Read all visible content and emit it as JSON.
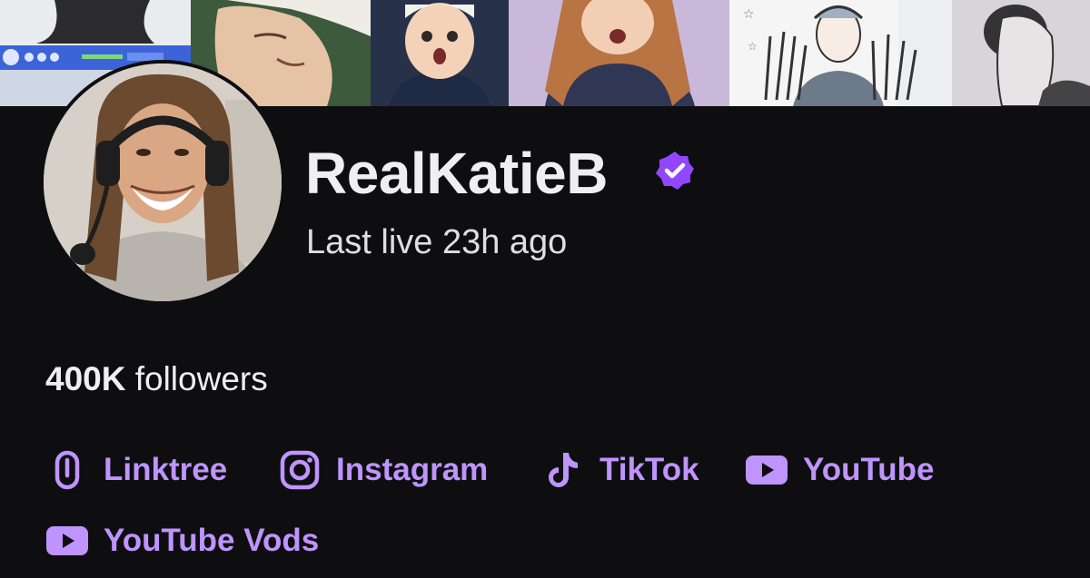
{
  "channel": {
    "name": "RealKatieB",
    "verified": true,
    "last_live": "Last live 23h ago",
    "followers_count": "400K",
    "followers_label": "followers"
  },
  "social_links": [
    {
      "label": "Linktree",
      "icon": "linktree-icon"
    },
    {
      "label": "Instagram",
      "icon": "instagram-icon"
    },
    {
      "label": "TikTok",
      "icon": "tiktok-icon"
    },
    {
      "label": "YouTube",
      "icon": "youtube-icon"
    },
    {
      "label": "YouTube Vods",
      "icon": "youtube-icon"
    }
  ],
  "colors": {
    "background": "#0e0e10",
    "accent": "#bf94ff",
    "verified_badge": "#9147ff",
    "text_primary": "#efeff1",
    "text_secondary": "#dedee3"
  }
}
